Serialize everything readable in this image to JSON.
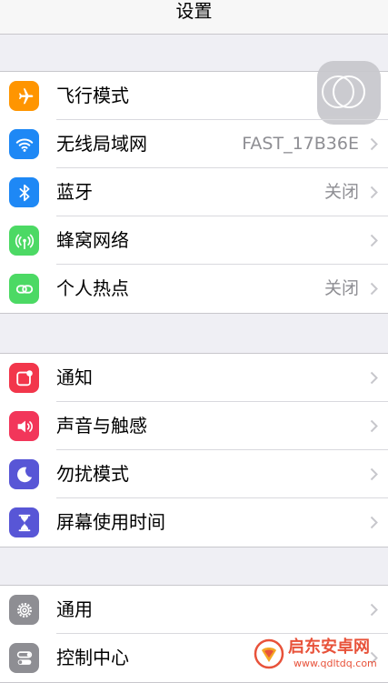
{
  "nav": {
    "title": "设置"
  },
  "groups": [
    {
      "rows": [
        {
          "name": "airplane-mode",
          "label": "飞行模式",
          "value": "",
          "icon": "airplane-icon",
          "color": "#ff9500",
          "control": "toggle",
          "toggle_on": false
        },
        {
          "name": "wifi",
          "label": "无线局域网",
          "value": "FAST_17B36E",
          "icon": "wifi-icon",
          "color": "#1e88f5",
          "control": "chevron"
        },
        {
          "name": "bluetooth",
          "label": "蓝牙",
          "value": "关闭",
          "icon": "bluetooth-icon",
          "color": "#1e88f5",
          "control": "chevron"
        },
        {
          "name": "cellular",
          "label": "蜂窝网络",
          "value": "",
          "icon": "cellular-antenna-icon",
          "color": "#4cd964",
          "control": "chevron"
        },
        {
          "name": "personal-hotspot",
          "label": "个人热点",
          "value": "关闭",
          "icon": "hotspot-link-icon",
          "color": "#4cd964",
          "control": "chevron"
        }
      ]
    },
    {
      "rows": [
        {
          "name": "notifications",
          "label": "通知",
          "value": "",
          "icon": "notification-badge-icon",
          "color": "#f2364b",
          "control": "chevron"
        },
        {
          "name": "sounds-haptics",
          "label": "声音与触感",
          "value": "",
          "icon": "speaker-icon",
          "color": "#f2365a",
          "control": "chevron"
        },
        {
          "name": "do-not-disturb",
          "label": "勿扰模式",
          "value": "",
          "icon": "moon-icon",
          "color": "#5856d6",
          "control": "chevron"
        },
        {
          "name": "screen-time",
          "label": "屏幕使用时间",
          "value": "",
          "icon": "hourglass-icon",
          "color": "#5856d6",
          "control": "chevron"
        }
      ]
    },
    {
      "rows": [
        {
          "name": "general",
          "label": "通用",
          "value": "",
          "icon": "gear-icon",
          "color": "#8e8e93",
          "control": "chevron"
        },
        {
          "name": "control-center",
          "label": "控制中心",
          "value": "",
          "icon": "switches-icon",
          "color": "#8e8e93",
          "control": "chevron"
        }
      ]
    }
  ],
  "watermark": {
    "name": "启东安卓网",
    "url": "www.qdltdq.com",
    "color": "#e8523a"
  }
}
